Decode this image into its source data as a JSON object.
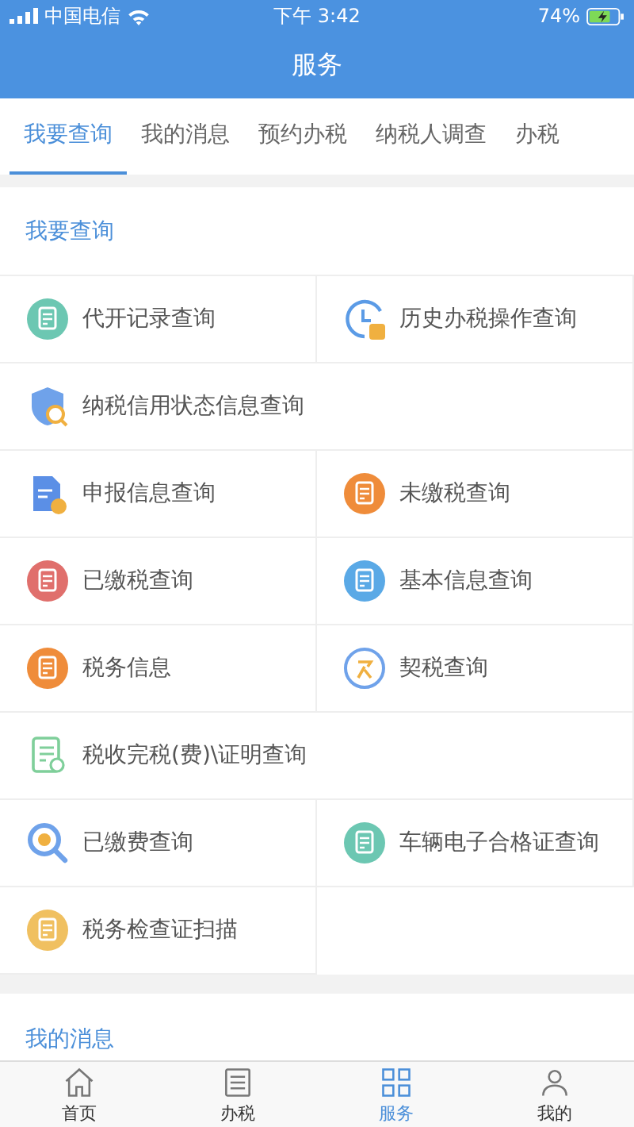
{
  "status_bar": {
    "carrier": "中国电信",
    "time": "下午 3:42",
    "battery": "74%"
  },
  "title": "服务",
  "tabs": [
    {
      "label": "我要查询",
      "selected": true
    },
    {
      "label": "我的消息",
      "selected": false
    },
    {
      "label": "预约办税",
      "selected": false
    },
    {
      "label": "纳税人调查",
      "selected": false
    },
    {
      "label": "办税",
      "selected": false
    }
  ],
  "section": {
    "title": "我要查询"
  },
  "rows": [
    [
      {
        "label": "代开记录查询",
        "kind": "circle",
        "color": "#6cc7b2"
      },
      {
        "label": "历史办税操作查询",
        "kind": "clock",
        "color": "#5b9be6"
      }
    ],
    [
      {
        "label": "纳税信用状态信息查询",
        "kind": "shield",
        "color": "#6fa2ea"
      }
    ],
    [
      {
        "label": "申报信息查询",
        "kind": "doc",
        "color": "#5b8fe6"
      },
      {
        "label": "未缴税查询",
        "kind": "circle",
        "color": "#ef8c3a"
      }
    ],
    [
      {
        "label": "已缴税查询",
        "kind": "circle",
        "color": "#e06f6c"
      },
      {
        "label": "基本信息查询",
        "kind": "circle",
        "color": "#5aa9e6"
      }
    ],
    [
      {
        "label": "税务信息",
        "kind": "circle",
        "color": "#ef8c3a"
      },
      {
        "label": "契税查询",
        "kind": "ring",
        "color": "#6fa2ea"
      }
    ],
    [
      {
        "label": "税收完税(费)\\证明查询",
        "kind": "certificate",
        "color": "#7fcf9a"
      }
    ],
    [
      {
        "label": "已缴费查询",
        "kind": "magnifier",
        "color": "#6fa2ea"
      },
      {
        "label": "车辆电子合格证查询",
        "kind": "circle",
        "color": "#6cc7b2"
      }
    ],
    [
      {
        "label": "税务检查证扫描",
        "kind": "circle",
        "color": "#f0c060"
      }
    ]
  ],
  "next_section": {
    "title": "我的消息"
  },
  "tab_bar": [
    {
      "label": "首页",
      "kind": "home",
      "selected": false
    },
    {
      "label": "办税",
      "kind": "list",
      "selected": false
    },
    {
      "label": "服务",
      "kind": "grid",
      "selected": true
    },
    {
      "label": "我的",
      "kind": "person",
      "selected": false
    }
  ]
}
